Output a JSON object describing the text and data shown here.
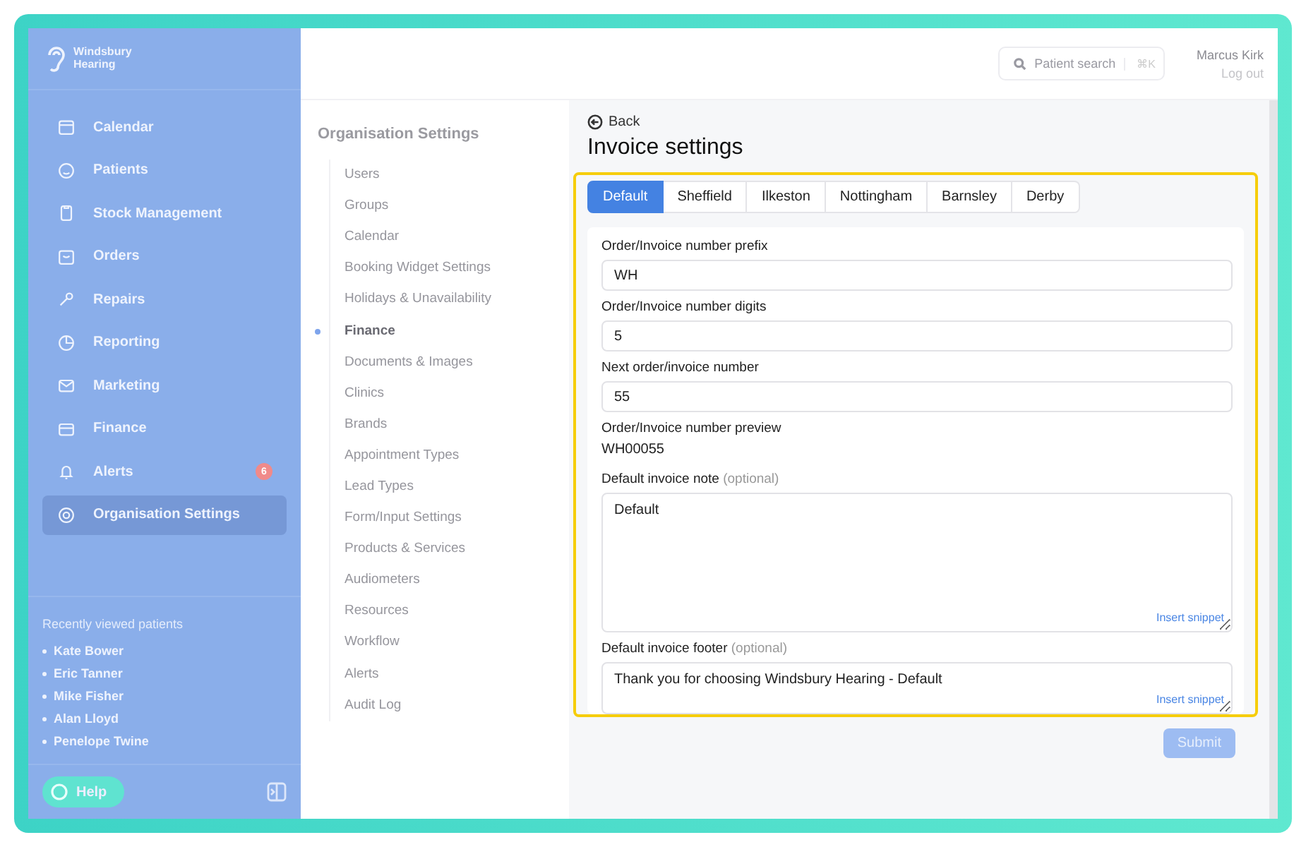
{
  "sidebar": {
    "logo": "Windsbury Hearing",
    "items": [
      {
        "label": "Calendar",
        "selected": false
      },
      {
        "label": "Patients",
        "selected": false
      },
      {
        "label": "Stock Management",
        "selected": false
      },
      {
        "label": "Orders",
        "selected": false
      },
      {
        "label": "Repairs",
        "selected": false
      },
      {
        "label": "Reporting",
        "selected": false
      },
      {
        "label": "Marketing",
        "selected": false
      },
      {
        "label": "Finance",
        "selected": false
      },
      {
        "label": "Alerts",
        "selected": false,
        "badge": "6"
      },
      {
        "label": "Organisation Settings",
        "selected": true
      }
    ],
    "recent": {
      "heading": "Recently viewed patients",
      "patients": [
        "Kate Bower",
        "Eric Tanner",
        "Mike Fisher",
        "Alan Lloyd",
        "Penelope Twine"
      ]
    },
    "help": "Help"
  },
  "topbar": {
    "search": {
      "placeholder": "Patient search",
      "shortcut": "⌘K"
    },
    "user": "Marcus Kirk",
    "logout": "Log out"
  },
  "settings_nav": {
    "title": "Organisation Settings",
    "items": [
      {
        "label": "Users",
        "selected": false
      },
      {
        "label": "Groups",
        "selected": false
      },
      {
        "label": "Calendar",
        "selected": false
      },
      {
        "label": "Booking Widget Settings",
        "selected": false
      },
      {
        "label": "Holidays & Unavailability",
        "selected": false
      },
      {
        "label": "Finance",
        "selected": true
      },
      {
        "label": "Documents & Images",
        "selected": false
      },
      {
        "label": "Clinics",
        "selected": false
      },
      {
        "label": "Brands",
        "selected": false
      },
      {
        "label": "Appointment Types",
        "selected": false
      },
      {
        "label": "Lead Types",
        "selected": false
      },
      {
        "label": "Form/Input Settings",
        "selected": false
      },
      {
        "label": "Products & Services",
        "selected": false
      },
      {
        "label": "Audiometers",
        "selected": false
      },
      {
        "label": "Resources",
        "selected": false
      },
      {
        "label": "Workflow",
        "selected": false
      },
      {
        "label": "Alerts",
        "selected": false
      },
      {
        "label": "Audit Log",
        "selected": false
      }
    ]
  },
  "main": {
    "back": "Back",
    "title": "Invoice settings",
    "tabs": [
      {
        "label": "Default",
        "selected": true
      },
      {
        "label": "Sheffield",
        "selected": false
      },
      {
        "label": "Ilkeston",
        "selected": false
      },
      {
        "label": "Nottingham",
        "selected": false
      },
      {
        "label": "Barnsley",
        "selected": false
      },
      {
        "label": "Derby",
        "selected": false
      }
    ],
    "fields": [
      {
        "kind": "input",
        "label": "Order/Invoice number prefix",
        "value": "WH"
      },
      {
        "kind": "input",
        "label": "Order/Invoice number digits",
        "value": "5"
      },
      {
        "kind": "input",
        "label": "Next order/invoice number",
        "value": "55"
      },
      {
        "kind": "readout",
        "label": "Order/Invoice number preview",
        "value": "WH00055"
      },
      {
        "kind": "textarea-large",
        "label": "Default invoice note",
        "optional": "(optional)",
        "value": "Default",
        "snippet": "Insert snippet"
      },
      {
        "kind": "textarea",
        "label": "Default invoice footer",
        "optional": "(optional)",
        "value": "Thank you for choosing Windsbury Hearing - Default",
        "snippet": "Insert snippet"
      }
    ],
    "submit": "Submit"
  }
}
